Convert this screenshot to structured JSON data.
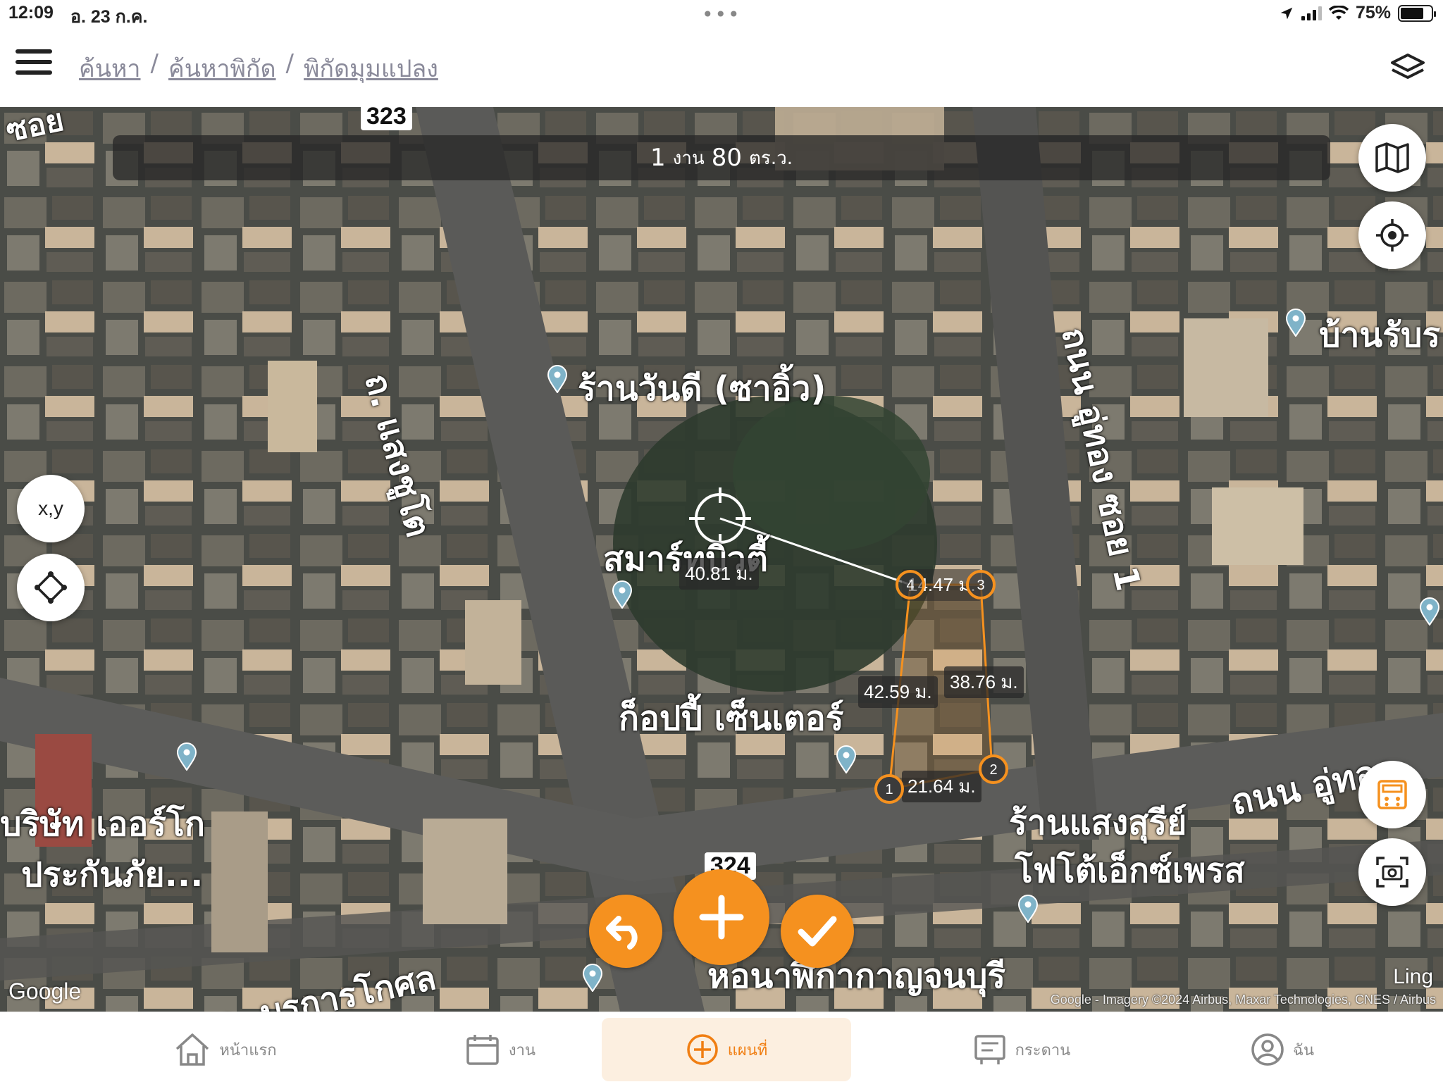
{
  "status_bar": {
    "time": "12:09",
    "date": "อ. 23 ก.ค.",
    "dots": "•••",
    "battery": "75%",
    "battery_level": 0.75
  },
  "header": {
    "breadcrumb": [
      "ค้นหา",
      "ค้นหาพิกัด",
      "พิกัดมุมแปลง"
    ],
    "separator": "/"
  },
  "map": {
    "area": {
      "value1": "1",
      "unit1": "งาน",
      "value2": "80",
      "unit2": "ตร.ว."
    },
    "buttons": {
      "xy_label": "x,y"
    },
    "place_labels": {
      "road_1": "ถ. แสงชูโต",
      "road_2": "ถนน อู่ทอง ซอย 1",
      "road_3": "ถนน อู่ทอง",
      "road_4": "ถ. บรการโกศล",
      "road_5": "ซอย",
      "shop_1": "ร้านวันดี (ซาอิ้ว)",
      "shop_2": "สมาร์ทบิวตี้",
      "shop_3": "ก็อปปี้ เซ็นเตอร์",
      "shop_4_line1": "ร้านแสงสุรีย์",
      "shop_4_line2": "โฟโต้เอ็กซ์เพรส",
      "company_line1": "บริษัท เออร์โก",
      "company_line2": "ประกันภัย...",
      "hall": "หอนาฬิกากาญจนบุรี",
      "right_label": "บ้านรับร"
    },
    "road_shields": [
      "323",
      "324"
    ],
    "measurements": {
      "center_distance": "40.81 ม.",
      "top_edge": "14.47 ม.",
      "left_edge": "42.59 ม.",
      "right_edge": "38.76 ม.",
      "bottom_edge": "21.64 ม."
    },
    "vertices": [
      "1",
      "2",
      "3",
      "4"
    ],
    "google": "Google",
    "attribution": "Google - Imagery ©2024 Airbus, Maxar Technologies, CNES / Airbus",
    "ling": "Ling"
  },
  "tabs": [
    {
      "label": "หน้าแรก",
      "icon": "home-icon"
    },
    {
      "label": "งาน",
      "icon": "calendar-icon"
    },
    {
      "label": "แผนที่",
      "icon": "plus-circle-icon",
      "active": true
    },
    {
      "label": "กระดาน",
      "icon": "board-icon"
    },
    {
      "label": "ฉัน",
      "icon": "user-icon"
    }
  ],
  "colors": {
    "accent": "#f5911f",
    "plot_line": "#f5911f",
    "active_tab_bg": "#fcefe0"
  }
}
